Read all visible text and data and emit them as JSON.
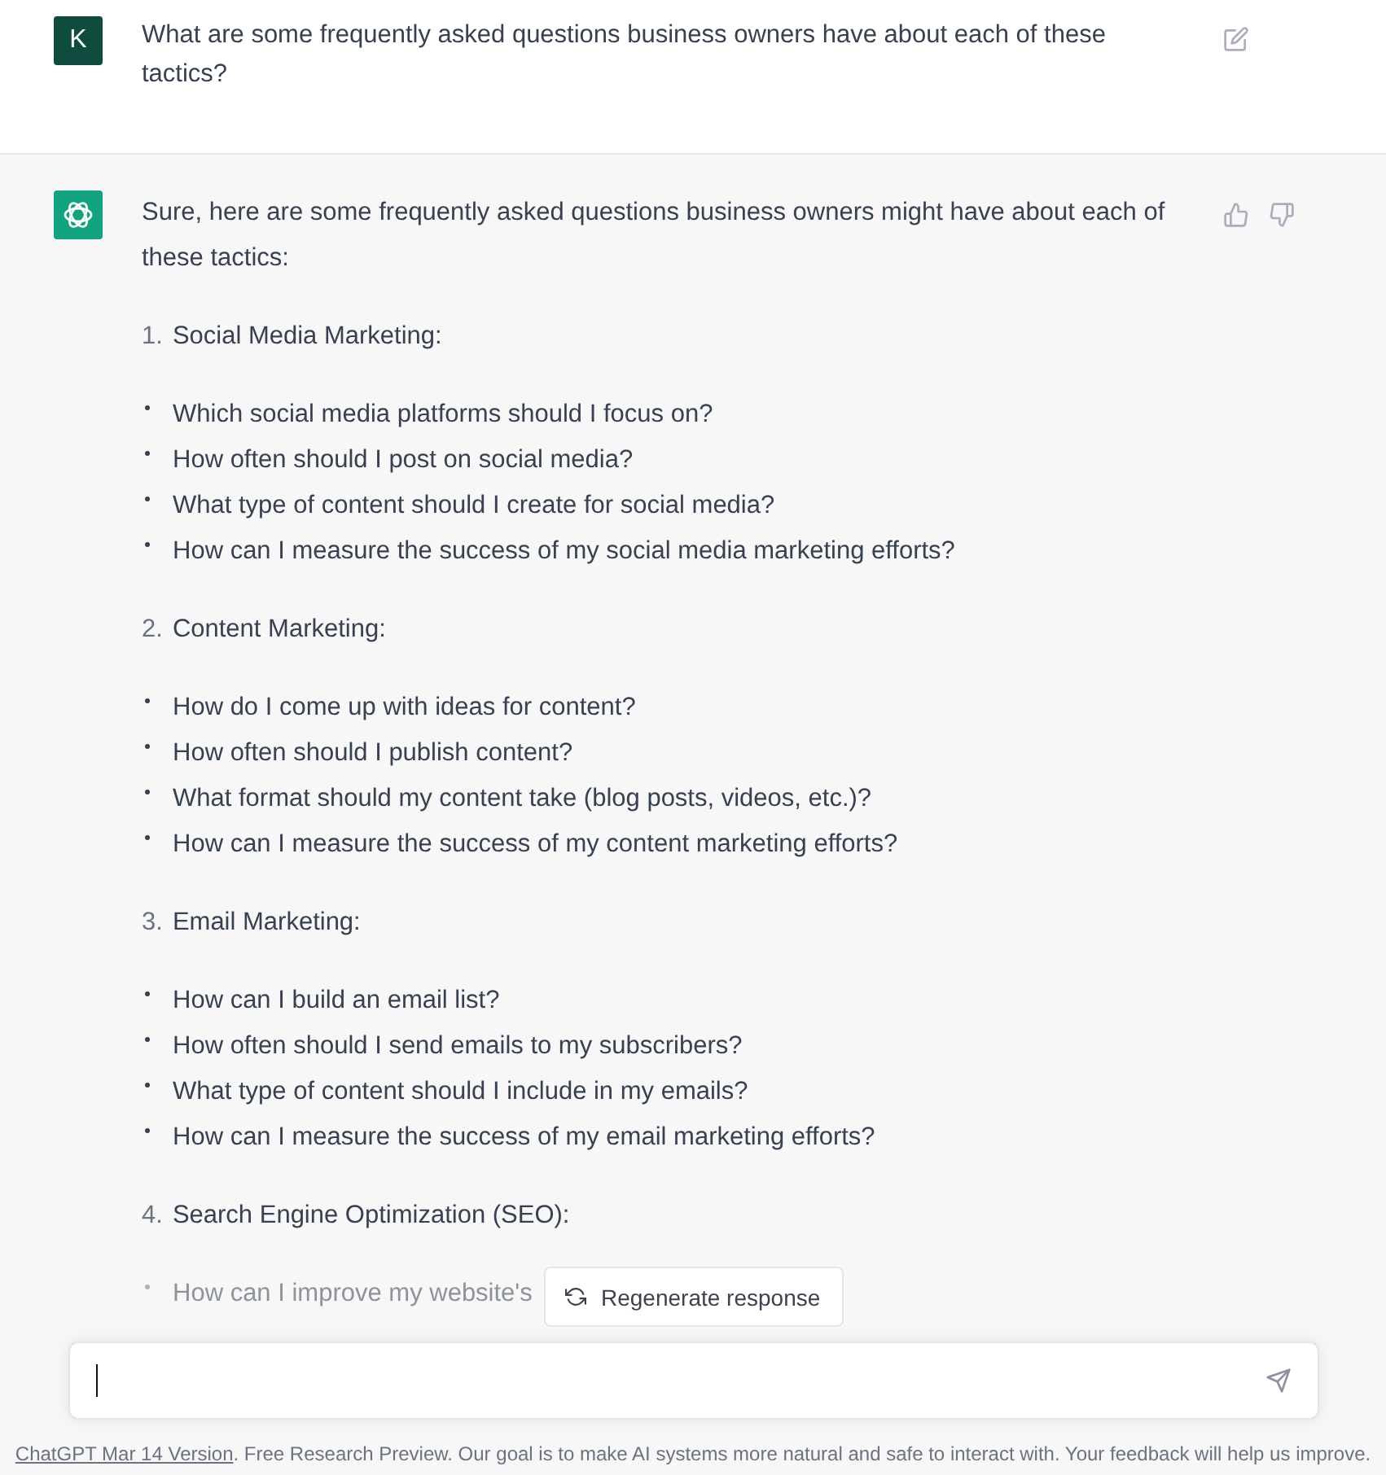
{
  "user_message": {
    "avatar_letter": "K",
    "text": "What are some frequently asked questions business owners have about each of these tactics?"
  },
  "assistant_message": {
    "intro": "Sure, here are some frequently asked questions business owners might have about each of these tactics:",
    "sections": [
      {
        "number": "1.",
        "title": "Social Media Marketing:",
        "bullets": [
          "Which social media platforms should I focus on?",
          "How often should I post on social media?",
          "What type of content should I create for social media?",
          "How can I measure the success of my social media marketing efforts?"
        ]
      },
      {
        "number": "2.",
        "title": "Content Marketing:",
        "bullets": [
          "How do I come up with ideas for content?",
          "How often should I publish content?",
          "What format should my content take (blog posts, videos, etc.)?",
          "How can I measure the success of my content marketing efforts?"
        ]
      },
      {
        "number": "3.",
        "title": "Email Marketing:",
        "bullets": [
          "How can I build an email list?",
          "How often should I send emails to my subscribers?",
          "What type of content should I include in my emails?",
          "How can I measure the success of my email marketing efforts?"
        ]
      },
      {
        "number": "4.",
        "title": "Search Engine Optimization (SEO):",
        "bullets": [
          "How can I improve my website's"
        ]
      }
    ]
  },
  "regenerate_button": "Regenerate response",
  "footer": {
    "link": "ChatGPT Mar 14 Version",
    "text": ". Free Research Preview. Our goal is to make AI systems more natural and safe to interact with. Your feedback will help us improve."
  }
}
